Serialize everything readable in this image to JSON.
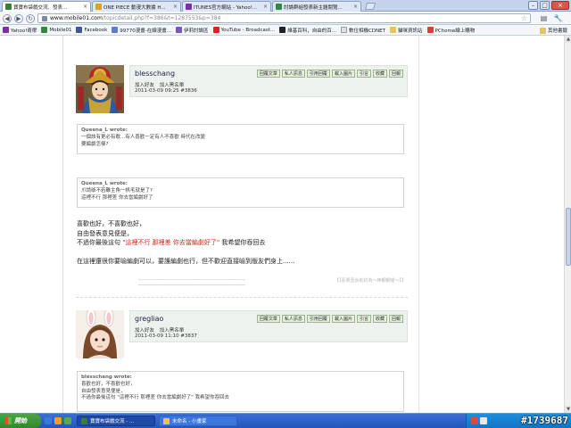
{
  "browser": {
    "tabs": [
      {
        "title": "寶寶布袋戲交流、發表...",
        "close": "×",
        "icon_color": "#3b7f2e",
        "active": true
      },
      {
        "title": "ONE PIECE 動漫大數據 H...",
        "close": "×",
        "icon_color": "#d8a32a",
        "active": false
      },
      {
        "title": "ITUNES官方網站 - Yahoo!...",
        "close": "×",
        "icon_color": "#7b2fa8",
        "active": false
      },
      {
        "title": "討論群組發表新主題閱覽...",
        "close": "×",
        "icon_color": "#2f8a3b",
        "active": false
      }
    ],
    "window_buttons": {
      "minimize": "–",
      "maximize": "□",
      "close": "×"
    },
    "nav": {
      "back": "◀",
      "forward": "▶",
      "reload": "↻"
    },
    "address": {
      "host": "www.mobile01.com",
      "path": "/topicdetail.php?f=386&t=1287553&p=384",
      "star": "☆"
    },
    "tool_icons": {
      "page": "▤",
      "wrench": "🔧"
    },
    "bookmarks": [
      {
        "label": "Yahoo!奇摩",
        "icon_color": "#7b2fa8"
      },
      {
        "label": "Mobile01",
        "icon_color": "#2f8a3b"
      },
      {
        "label": "Facebook",
        "icon_color": "#3b5998"
      },
      {
        "label": "99770漫畫-在線漫畫...",
        "icon_color": "#5a7bd1"
      },
      {
        "label": "伊莉討論區",
        "icon_color": "#7a56c2"
      },
      {
        "label": "YouTube - Broadcast...",
        "icon_color": "#d22"
      },
      {
        "label": "維基百科，自由的百...",
        "icon_color": "#222"
      },
      {
        "label": "數位相機CDNET",
        "icon_color": "#e0e0e0"
      },
      {
        "label": "貓咪資訊站",
        "icon_color": "#e6c45a"
      },
      {
        "label": "PChome線上購物",
        "icon_color": "#d0443a"
      }
    ],
    "other_bookmarks": "其他書籤"
  },
  "posts": [
    {
      "username": "blesschang",
      "user_links": [
        "加入好友",
        "加入黑名單"
      ],
      "meta": "2011-03-09 09:25 #3836",
      "actions": [
        "回覆文章",
        "私人訊息",
        "引用回覆",
        "載入圖片",
        "引言",
        "收藏",
        "回報"
      ],
      "quotes": [
        {
          "author": "Queena_L wrote:",
          "lines": [
            "一個該有更必有歌...有人喜歡一定有人不喜歡 時代在改變",
            "要編劇怎樣?"
          ]
        },
        {
          "author": "Queena_L wrote:",
          "lines": [
            "爪請爺不若雖主角一帆毛就是了?",
            "這裡不行 那裡差 你去當編劇好了"
          ]
        }
      ],
      "body": {
        "line1": "喜歡也好，不喜歡也好，",
        "line2": "自由發表意見便是，",
        "line3_prefix": "不過你最後這句 ",
        "line3_red": "\"這裡不行 那裡差 你去當編劇好了\"",
        "line3_suffix": " 我希望你吞回去",
        "line4": "在這裡還很你要喻編劇可以，要護編劇也行，但不歡迎直接喻到版友們身上......"
      },
      "signature": {
        "left": "一一一一一一一一一一一一一一一一一一一一一一一一",
        "right": "【【喜果壹余就的為～神鋼鋼喵～】】"
      }
    },
    {
      "username": "gregliao",
      "user_links": [
        "加入好友",
        "加入黑名單"
      ],
      "meta": "2011-03-09 11:10 #3837",
      "actions": [
        "回覆文章",
        "私人訊息",
        "引用回覆",
        "載入圖片",
        "引言",
        "收藏",
        "回報"
      ],
      "quotes": [
        {
          "author": "blesschang wrote:",
          "lines": [
            "喜歡也好，不喜歡也好，",
            "自由發表意見便是，",
            "不過你最後這句 \"這裡不行 那裡差 你去當編劇好了\" 我希望你吞回去"
          ]
        }
      ]
    }
  ],
  "taskbar": {
    "start_label": "開始",
    "buttons": [
      {
        "label": "寶寶布袋戲交流 - ...",
        "icon_color": "#3b7f2e",
        "active": true
      },
      {
        "label": "未命名 - 小畫家",
        "icon_color": "#e6c45a",
        "active": false
      }
    ],
    "watermark": "#1739687"
  }
}
